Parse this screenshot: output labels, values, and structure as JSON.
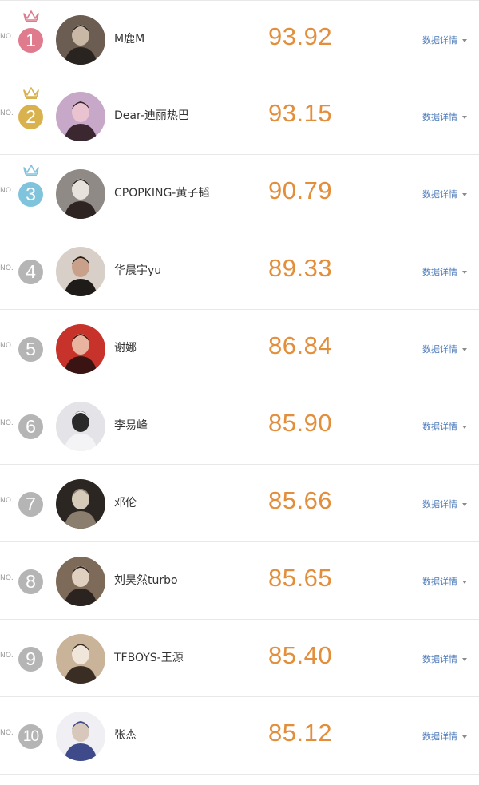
{
  "no_label": "NO.",
  "detail_label": "数据详情",
  "colors": {
    "score": "#e28e3b",
    "detail": "#4a78b8",
    "rank_default": "#b5b5b5"
  },
  "rows": [
    {
      "rank": "1",
      "name": "M鹿M",
      "score": "93.92",
      "badge_color": "#e07b8e",
      "crown": "crown-icon-pink",
      "crown_color": "#e07b8e"
    },
    {
      "rank": "2",
      "name": "Dear-迪丽热巴",
      "score": "93.15",
      "badge_color": "#d9b24e",
      "crown": "crown-icon-gold",
      "crown_color": "#d9b24e"
    },
    {
      "rank": "3",
      "name": "CPOPKING-黄子韬",
      "score": "90.79",
      "badge_color": "#7fc4dc",
      "crown": "crown-icon-blue",
      "crown_color": "#7fc4dc"
    },
    {
      "rank": "4",
      "name": "华晨宇yu",
      "score": "89.33",
      "badge_color": "#b5b5b5"
    },
    {
      "rank": "5",
      "name": "谢娜",
      "score": "86.84",
      "badge_color": "#b5b5b5"
    },
    {
      "rank": "6",
      "name": "李易峰",
      "score": "85.90",
      "badge_color": "#b5b5b5"
    },
    {
      "rank": "7",
      "name": "邓伦",
      "score": "85.66",
      "badge_color": "#b5b5b5"
    },
    {
      "rank": "8",
      "name": "刘昊然turbo",
      "score": "85.65",
      "badge_color": "#b5b5b5"
    },
    {
      "rank": "9",
      "name": "TFBOYS-王源",
      "score": "85.40",
      "badge_color": "#b5b5b5"
    },
    {
      "rank": "10",
      "name": "张杰",
      "score": "85.12",
      "badge_color": "#b5b5b5"
    }
  ]
}
